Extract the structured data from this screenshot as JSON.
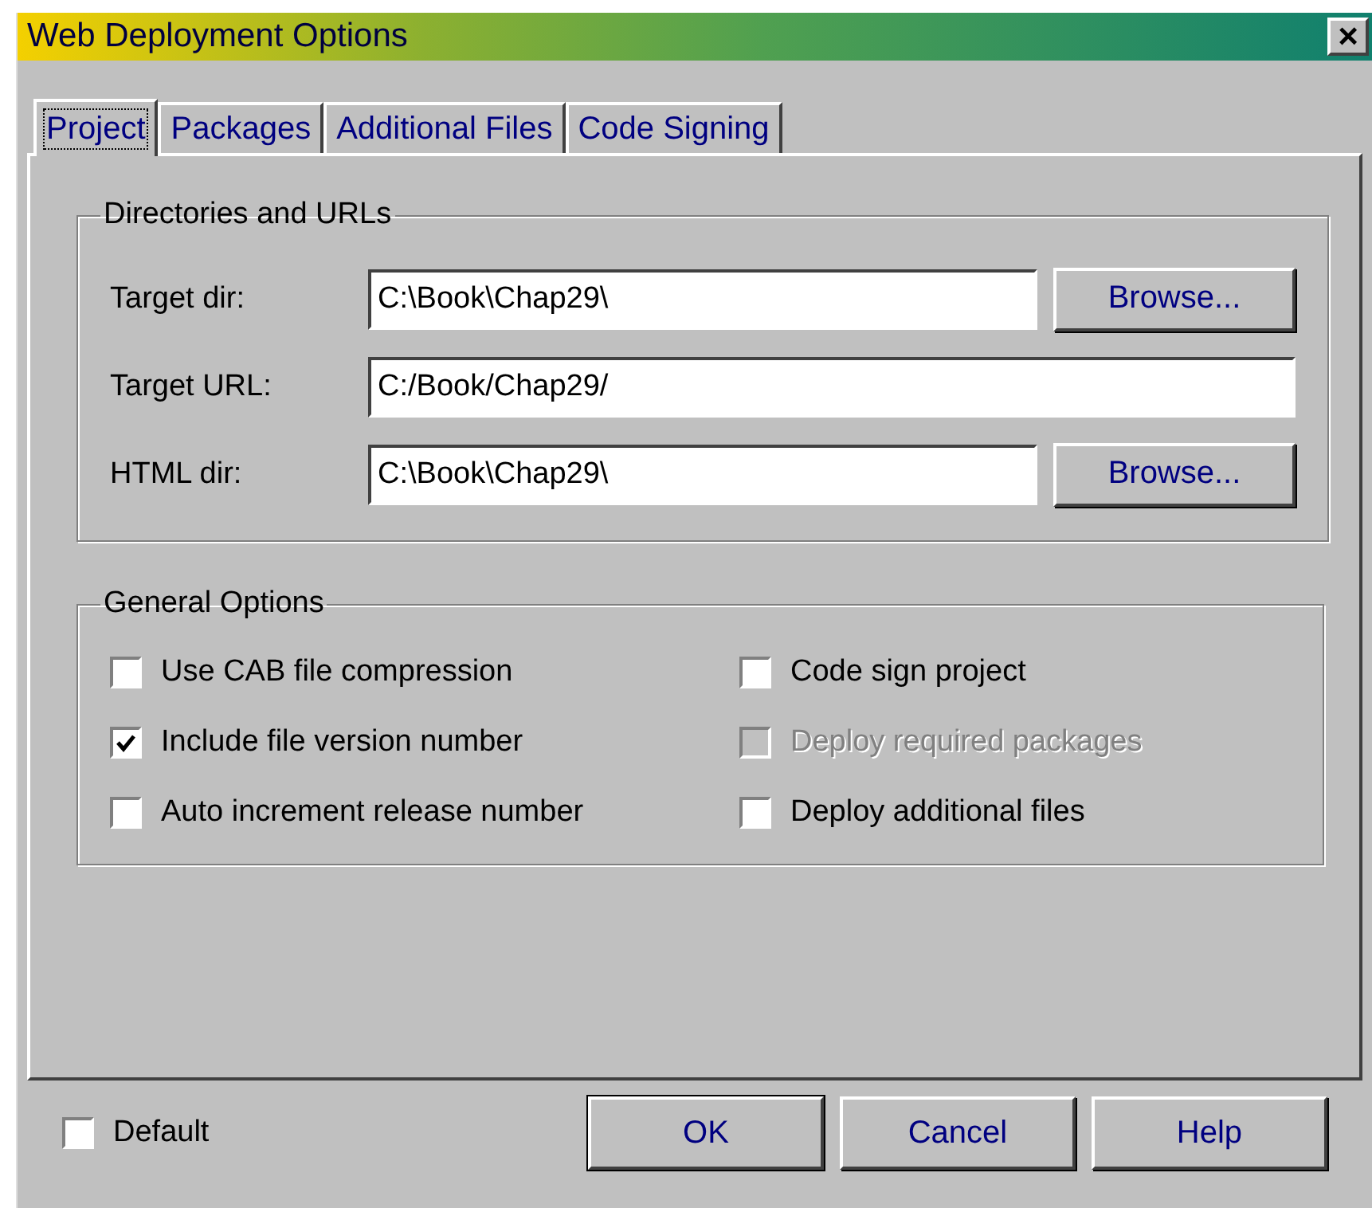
{
  "window": {
    "title": "Web Deployment Options",
    "close": "×"
  },
  "tabs": [
    {
      "label": "Project",
      "selected": true
    },
    {
      "label": "Packages",
      "selected": false
    },
    {
      "label": "Additional Files",
      "selected": false
    },
    {
      "label": "Code Signing",
      "selected": false
    }
  ],
  "directories": {
    "title": "Directories and URLs",
    "rows": [
      {
        "label": "Target dir:",
        "value": "C:\\Book\\Chap29\\",
        "button": "Browse..."
      },
      {
        "label": "Target URL:",
        "value": "C:/Book/Chap29/"
      },
      {
        "label": "HTML dir:",
        "value": "C:\\Book\\Chap29\\",
        "button": "Browse..."
      }
    ]
  },
  "general_options": {
    "title": "General Options",
    "options": [
      {
        "label": "Use CAB file compression",
        "checked": false,
        "disabled": false
      },
      {
        "label": "Code sign project",
        "checked": false,
        "disabled": false
      },
      {
        "label": "Include file version number",
        "checked": true,
        "disabled": false
      },
      {
        "label": "Deploy required packages",
        "checked": false,
        "disabled": true
      },
      {
        "label": "Auto increment release number",
        "checked": false,
        "disabled": false
      },
      {
        "label": "Deploy additional files",
        "checked": false,
        "disabled": false
      }
    ]
  },
  "default_option": {
    "label": "Default",
    "checked": false
  },
  "buttons": [
    {
      "label": "OK",
      "default": true
    },
    {
      "label": "Cancel",
      "default": false
    },
    {
      "label": "Help",
      "default": false
    }
  ]
}
